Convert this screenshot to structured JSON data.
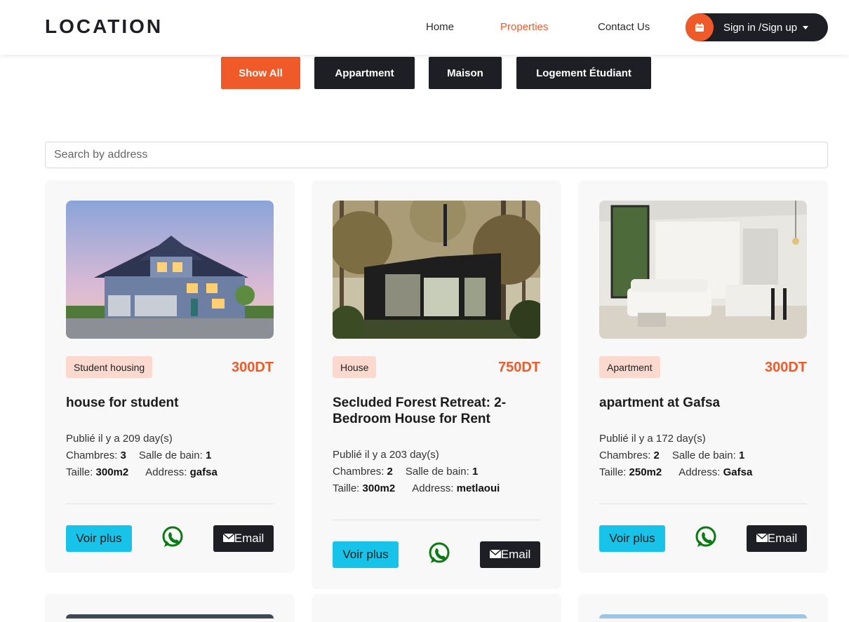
{
  "brand": {
    "logo": "LOCATION"
  },
  "nav": {
    "home": "Home",
    "properties": "Properties",
    "contact": "Contact Us",
    "signin": "Sign in /Sign up"
  },
  "filters": [
    "Show All",
    "Appartment",
    "Maison",
    "Logement Étudiant"
  ],
  "search": {
    "placeholder": "Search by address",
    "value": ""
  },
  "labels": {
    "published_prefix": "Publié il y a",
    "days_suffix": "day(s)",
    "rooms": "Chambres:",
    "baths": "Salle de bain:",
    "size": "Taille:",
    "address": "Address:",
    "more": "Voir plus",
    "email": "Email"
  },
  "colors": {
    "accent": "#f05a28",
    "dark": "#1e1f24",
    "cyan": "#17c3e8",
    "badge": "#fbd9cf",
    "whatsapp": "#0a7a12"
  },
  "listings": [
    {
      "type": "Student housing",
      "price": "300DT",
      "title": "house for student",
      "days": "209",
      "rooms": "3",
      "baths": "1",
      "size": "300m2",
      "address": "gafsa",
      "icon": "house-photo"
    },
    {
      "type": "House",
      "price": "750DT",
      "title": "Secluded Forest Retreat: 2-Bedroom House for Rent",
      "days": "203",
      "rooms": "2",
      "baths": "1",
      "size": "300m2",
      "address": "metlaoui",
      "icon": "forest-cabin-photo"
    },
    {
      "type": "Apartment",
      "price": "300DT",
      "title": "apartment at Gafsa",
      "days": "172",
      "rooms": "2",
      "baths": "1",
      "size": "250m2",
      "address": "Gafsa",
      "icon": "apartment-interior-photo"
    }
  ]
}
